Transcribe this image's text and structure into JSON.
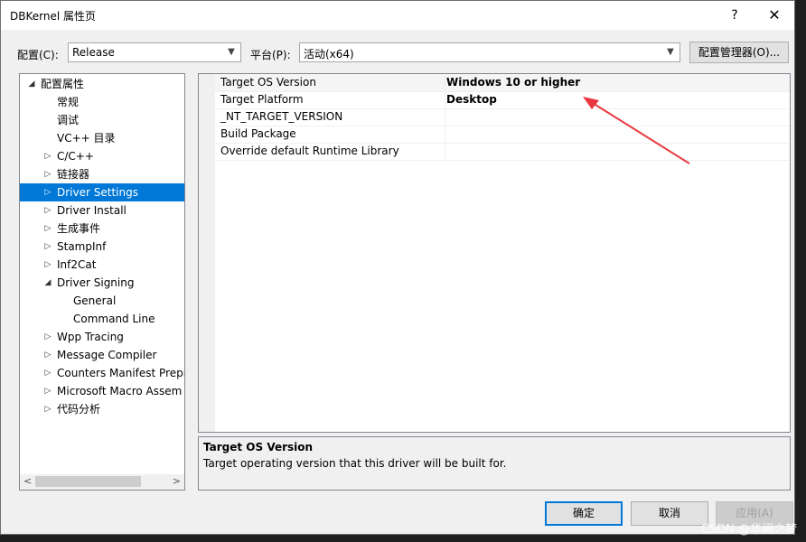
{
  "window": {
    "title": "DBKernel 属性页",
    "help_glyph": "?",
    "close_glyph": "✕"
  },
  "config": {
    "label": "配置(C):",
    "value": "Release",
    "platform_label": "平台(P):",
    "platform_value": "活动(x64)",
    "manager_button": "配置管理器(O)..."
  },
  "tree": {
    "items": [
      {
        "label": "配置属性",
        "expander": "◢",
        "level": 0
      },
      {
        "label": "常规",
        "expander": "",
        "level": 1
      },
      {
        "label": "调试",
        "expander": "",
        "level": 1
      },
      {
        "label": "VC++ 目录",
        "expander": "",
        "level": 1
      },
      {
        "label": "C/C++",
        "expander": "▷",
        "level": 1
      },
      {
        "label": "链接器",
        "expander": "▷",
        "level": 1
      },
      {
        "label": "Driver Settings",
        "expander": "▷",
        "level": 1,
        "selected": true
      },
      {
        "label": "Driver Install",
        "expander": "▷",
        "level": 1
      },
      {
        "label": "生成事件",
        "expander": "▷",
        "level": 1
      },
      {
        "label": "StampInf",
        "expander": "▷",
        "level": 1
      },
      {
        "label": "Inf2Cat",
        "expander": "▷",
        "level": 1
      },
      {
        "label": "Driver Signing",
        "expander": "◢",
        "level": 1
      },
      {
        "label": "General",
        "expander": "",
        "level": 2
      },
      {
        "label": "Command Line",
        "expander": "",
        "level": 2
      },
      {
        "label": "Wpp Tracing",
        "expander": "▷",
        "level": 1
      },
      {
        "label": "Message Compiler",
        "expander": "▷",
        "level": 1
      },
      {
        "label": "Counters Manifest Prepr",
        "expander": "▷",
        "level": 1
      },
      {
        "label": "Microsoft Macro Assem",
        "expander": "▷",
        "level": 1
      },
      {
        "label": "代码分析",
        "expander": "▷",
        "level": 1
      }
    ],
    "scroll_left": "<",
    "scroll_right": ">"
  },
  "properties": [
    {
      "name": "Target OS Version",
      "value": "Windows 10 or higher"
    },
    {
      "name": "Target Platform",
      "value": "Desktop"
    },
    {
      "name": "_NT_TARGET_VERSION",
      "value": ""
    },
    {
      "name": "Build Package",
      "value": ""
    },
    {
      "name": "Override default Runtime Library",
      "value": ""
    }
  ],
  "description": {
    "title": "Target OS Version",
    "text": "Target operating version that this driver will be built for."
  },
  "buttons": {
    "ok": "确定",
    "cancel": "取消",
    "apply": "应用(A)"
  },
  "watermark": "CSDN @华阙之梦",
  "colors": {
    "selection": "#0078d7",
    "annotation_arrow": "#e8383d"
  }
}
